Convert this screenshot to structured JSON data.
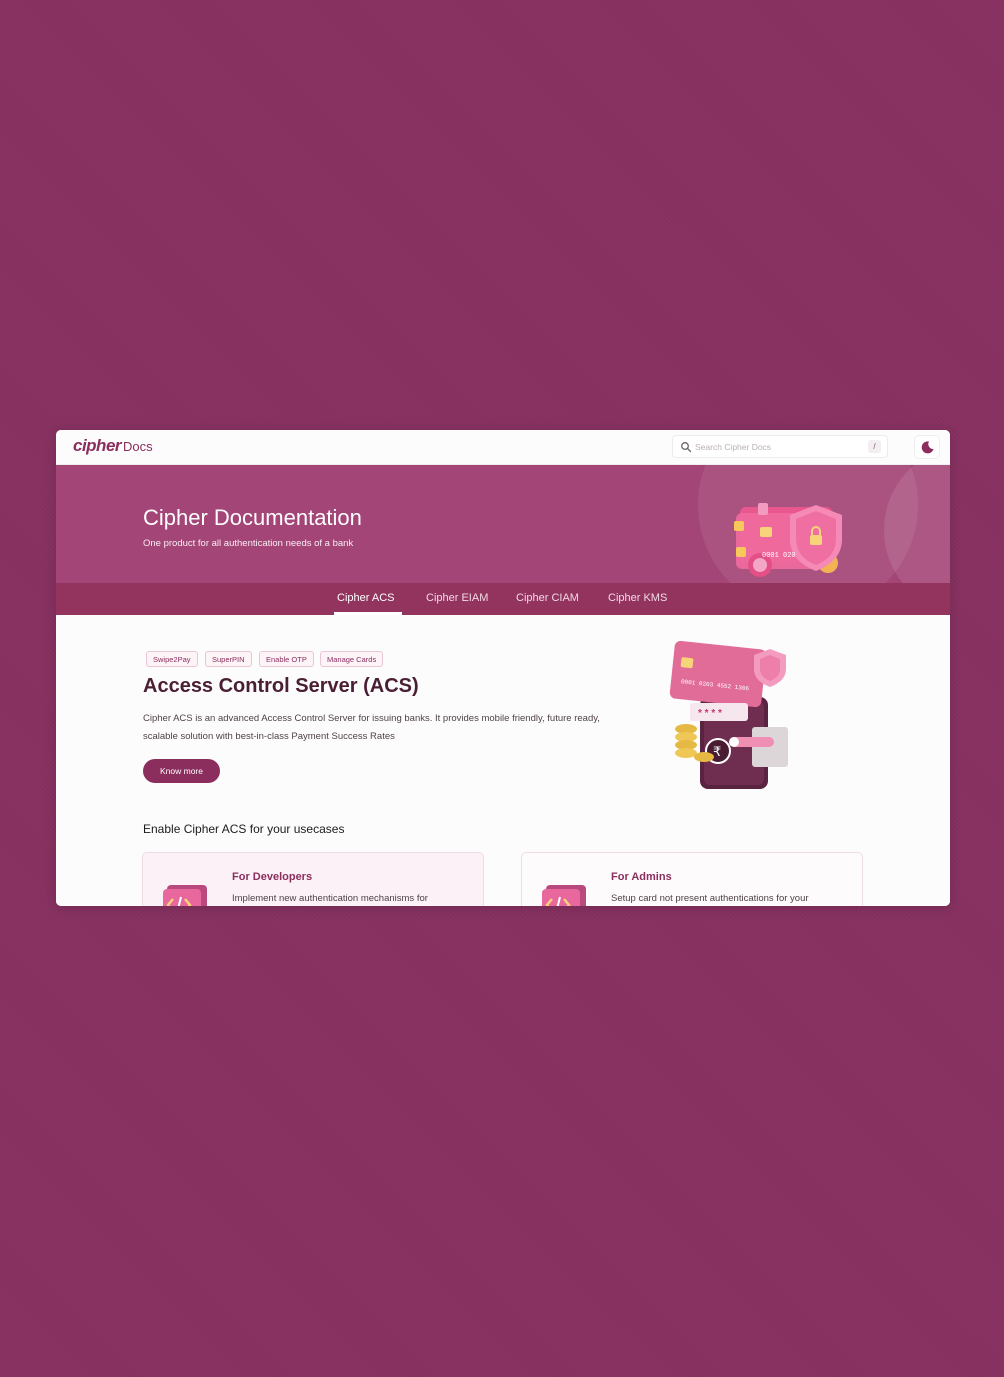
{
  "header": {
    "logo": "cipher",
    "product": "Docs",
    "search_placeholder": "Search Cipher Docs",
    "search_shortcut": "/"
  },
  "hero": {
    "title": "Cipher Documentation",
    "subtitle": "One product for all authentication needs of a bank",
    "card_number": "0001 020"
  },
  "tabs": [
    {
      "label": "Cipher ACS",
      "active": true
    },
    {
      "label": "Cipher EIAM",
      "active": false
    },
    {
      "label": "Cipher CIAM",
      "active": false
    },
    {
      "label": "Cipher KMS",
      "active": false
    }
  ],
  "main": {
    "chips": [
      "Swipe2Pay",
      "SuperPIN",
      "Enable OTP",
      "Manage Cards"
    ],
    "title": "Access Control Server (ACS)",
    "description": "Cipher ACS is an advanced Access Control Server for issuing banks. It provides mobile friendly, future ready, scalable solution with best-in-class Payment Success Rates",
    "cta": "Know more",
    "art_card_number": "0001 0203 4552 1306",
    "art_pin": "* * * *"
  },
  "usecases": {
    "title": "Enable Cipher ACS for your usecases",
    "cards": [
      {
        "title": "For Developers",
        "description": "Implement new authentication mechanisms for"
      },
      {
        "title": "For Admins",
        "description": "Setup card not present authentications for your"
      }
    ]
  },
  "colors": {
    "background": "#85305f",
    "brand": "#8b2d5d",
    "hero": "#a34577",
    "tabs": "#93345f"
  }
}
